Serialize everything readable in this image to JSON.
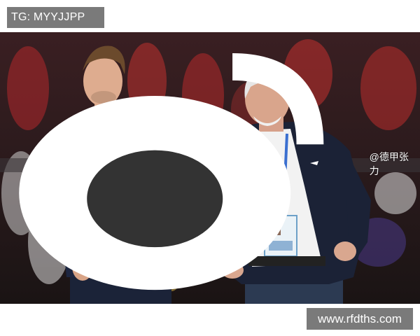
{
  "header": {
    "badge_text": "TG: MYYJJPP"
  },
  "photo": {
    "watermark_handle": "@德甲张力",
    "watermark_icon": "weibo-icon"
  },
  "footer": {
    "url_text": "www.rfdths.com"
  },
  "colors": {
    "badge_bg": "#7a7a7a",
    "badge_text": "#ffffff"
  }
}
